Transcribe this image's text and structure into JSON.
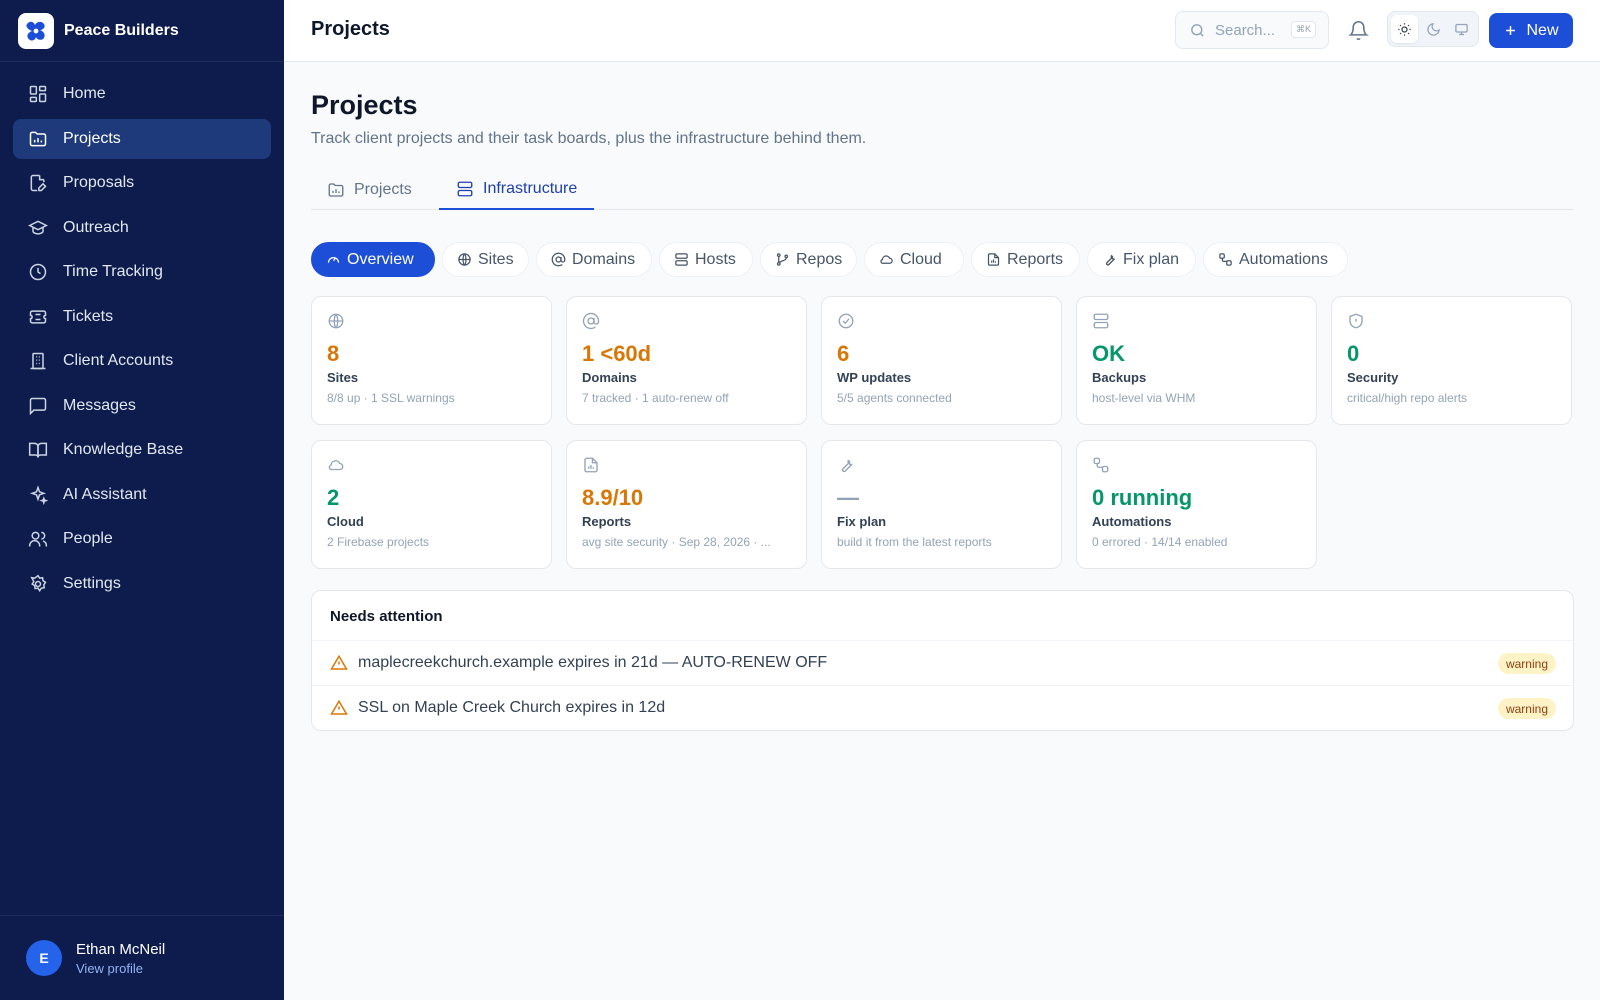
{
  "app": {
    "name": "Peace Builders"
  },
  "sidebar": {
    "items": [
      {
        "label": "Home",
        "icon": "grid-icon"
      },
      {
        "label": "Projects",
        "icon": "folder-chart-icon",
        "active": true
      },
      {
        "label": "Proposals",
        "icon": "file-pen-icon"
      },
      {
        "label": "Outreach",
        "icon": "graduation-cap-icon"
      },
      {
        "label": "Time Tracking",
        "icon": "clock-icon"
      },
      {
        "label": "Tickets",
        "icon": "ticket-icon"
      },
      {
        "label": "Client Accounts",
        "icon": "building-icon"
      },
      {
        "label": "Messages",
        "icon": "message-square-icon"
      },
      {
        "label": "Knowledge Base",
        "icon": "book-open-icon"
      },
      {
        "label": "AI Assistant",
        "icon": "sparkles-icon"
      },
      {
        "label": "People",
        "icon": "users-icon"
      },
      {
        "label": "Settings",
        "icon": "gear-icon"
      }
    ],
    "profile": {
      "initial": "E",
      "name": "Ethan McNeil",
      "link": "View profile"
    }
  },
  "topbar": {
    "title": "Projects",
    "search_placeholder": "Search...",
    "search_shortcut": "⌘K",
    "new_label": "New",
    "theme": "light"
  },
  "page": {
    "title": "Projects",
    "description": "Track client projects and their task boards, plus the infrastructure behind them.",
    "tabs": [
      {
        "label": "Projects",
        "active": false
      },
      {
        "label": "Infrastructure",
        "active": true
      }
    ],
    "pills": [
      {
        "label": "Overview",
        "active": true
      },
      {
        "label": "Sites"
      },
      {
        "label": "Domains"
      },
      {
        "label": "Hosts"
      },
      {
        "label": "Repos"
      },
      {
        "label": "Cloud"
      },
      {
        "label": "Reports"
      },
      {
        "label": "Fix plan"
      },
      {
        "label": "Automations"
      }
    ]
  },
  "cards": [
    {
      "icon": "globe-icon",
      "value": "8",
      "label": "Sites",
      "sub": "8/8 up · 1 SSL warnings",
      "tone": "orange"
    },
    {
      "icon": "at-sign-icon",
      "value": "1 <60d",
      "label": "Domains",
      "sub": "7 tracked · 1 auto-renew off",
      "tone": "orange"
    },
    {
      "icon": "check-circle-icon",
      "value": "6",
      "label": "WP updates",
      "sub": "5/5 agents connected",
      "tone": "orange"
    },
    {
      "icon": "server-icon",
      "value": "OK",
      "label": "Backups",
      "sub": "host-level via WHM",
      "tone": "green"
    },
    {
      "icon": "shield-icon",
      "value": "0",
      "label": "Security",
      "sub": "critical/high repo alerts",
      "tone": "green"
    },
    {
      "icon": "cloud-icon",
      "value": "2",
      "label": "Cloud",
      "sub": "2 Firebase projects",
      "tone": "green"
    },
    {
      "icon": "file-chart-icon",
      "value": "8.9/10",
      "label": "Reports",
      "sub": "avg site security · Sep 28, 2026 · ...",
      "tone": "orange"
    },
    {
      "icon": "wrench-icon",
      "value": "—",
      "label": "Fix plan",
      "sub": "build it from the latest reports",
      "tone": "muted"
    },
    {
      "icon": "workflow-icon",
      "value": "0 running",
      "label": "Automations",
      "sub": "0 errored · 14/14 enabled",
      "tone": "green"
    }
  ],
  "attention": {
    "title": "Needs attention",
    "items": [
      {
        "text": "maplecreekchurch.example expires in 21d — AUTO-RENEW OFF",
        "badge": "warning"
      },
      {
        "text": "SSL on Maple Creek Church expires in 12d",
        "badge": "warning"
      }
    ]
  },
  "colors": {
    "sidebar_bg": "#0e1b4d",
    "accent": "#1d4ed8",
    "orange": "#d97706",
    "green": "#059669",
    "muted": "#94a3b8",
    "warning_bg": "#fef3c7"
  }
}
